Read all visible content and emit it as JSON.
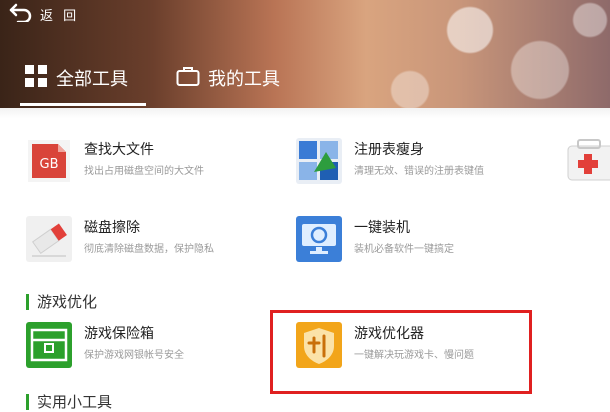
{
  "header": {
    "back_label": "返 回",
    "tabs": [
      {
        "label": "全部工具",
        "active": true
      },
      {
        "label": "我的工具",
        "active": false
      }
    ]
  },
  "tools": [
    {
      "name": "查找大文件",
      "desc": "找出占用磁盘空间的大文件",
      "icon": "gb-file-icon"
    },
    {
      "name": "注册表瘦身",
      "desc": "清理无效、错误的注册表键值",
      "icon": "registry-icon"
    },
    {
      "name": "磁盘擦除",
      "desc": "彻底清除磁盘数据，保护隐私",
      "icon": "eraser-icon"
    },
    {
      "name": "一键装机",
      "desc": "装机必备软件一键搞定",
      "icon": "monitor-install-icon"
    }
  ],
  "sections": [
    {
      "title": "游戏优化",
      "tools": [
        {
          "name": "游戏保险箱",
          "desc": "保护游戏网银帐号安全",
          "icon": "safe-box-icon"
        },
        {
          "name": "游戏优化器",
          "desc": "一键解决玩游戏卡、慢问题",
          "icon": "game-optimizer-icon",
          "highlighted": true
        }
      ]
    },
    {
      "title": "实用小工具"
    }
  ],
  "colors": {
    "accent_green": "#2ca02c",
    "highlight_red": "#e02020",
    "gb_red": "#d9443a",
    "optimizer_orange": "#f2a51a"
  }
}
